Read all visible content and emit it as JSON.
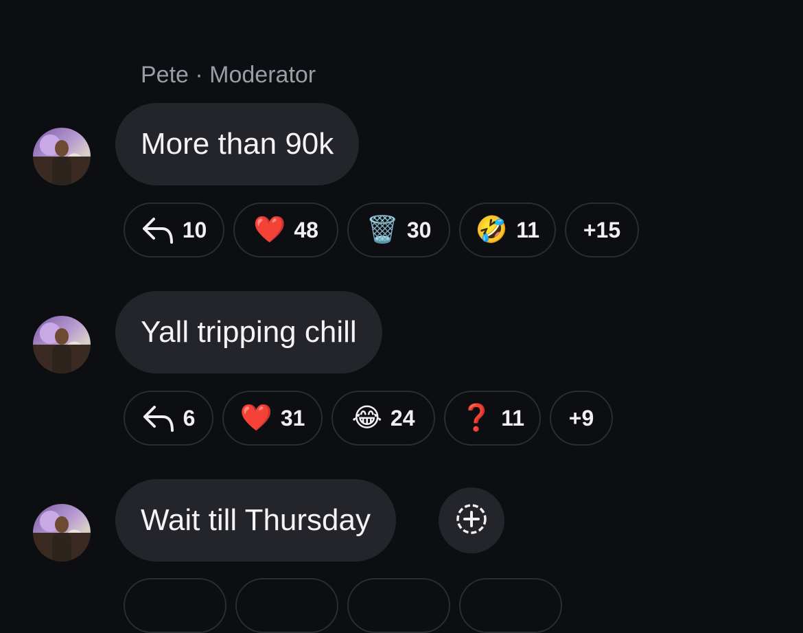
{
  "messages": [
    {
      "sender": "Pete · Moderator",
      "text": "More than 90k",
      "reactions": [
        {
          "icon": "reply-icon",
          "count": "10"
        },
        {
          "icon": "heart-emoji",
          "emoji": "❤️",
          "count": "48"
        },
        {
          "icon": "wastebasket-emoji",
          "emoji": "🗑️",
          "count": "30"
        },
        {
          "icon": "rofl-emoji",
          "emoji": "🤣",
          "count": "11"
        },
        {
          "icon": "more",
          "count": "+15"
        }
      ]
    },
    {
      "text": "Yall tripping chill",
      "reactions": [
        {
          "icon": "reply-icon",
          "count": "6"
        },
        {
          "icon": "heart-emoji",
          "emoji": "❤️",
          "count": "31"
        },
        {
          "icon": "joy-emoji",
          "emoji": "😂",
          "count": "24"
        },
        {
          "icon": "question-emoji",
          "emoji": "❓",
          "count": "11"
        },
        {
          "icon": "more",
          "count": "+9"
        }
      ]
    },
    {
      "text": "Wait till Thursday"
    }
  ],
  "colors": {
    "background": "#0d0e12",
    "bubble": "#23252b",
    "pill_border": "#2b2d33",
    "sender_text": "#9a9ca6"
  }
}
